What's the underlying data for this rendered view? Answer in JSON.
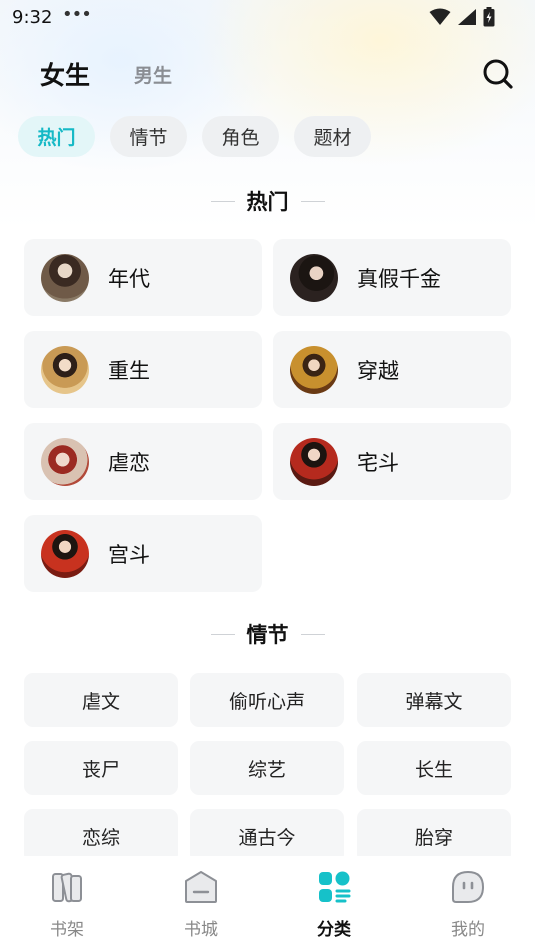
{
  "status_bar": {
    "time": "9:32",
    "dots": "•••"
  },
  "header": {
    "tab_female": "女生",
    "tab_male": "男生"
  },
  "chips": [
    {
      "label": "热门",
      "active": true
    },
    {
      "label": "情节",
      "active": false
    },
    {
      "label": "角色",
      "active": false
    },
    {
      "label": "题材",
      "active": false
    }
  ],
  "sections": {
    "hot_title": "热门",
    "plot_title": "情节"
  },
  "hot_items": [
    {
      "label": "年代",
      "avatar": "avatar-era"
    },
    {
      "label": "真假千金",
      "avatar": "avatar-true-false-heiress"
    },
    {
      "label": "重生",
      "avatar": "avatar-rebirth"
    },
    {
      "label": "穿越",
      "avatar": "avatar-time-travel"
    },
    {
      "label": "虐恋",
      "avatar": "avatar-tragic-love"
    },
    {
      "label": "宅斗",
      "avatar": "avatar-household-intrigue"
    },
    {
      "label": "宫斗",
      "avatar": "avatar-palace-intrigue"
    }
  ],
  "plot_items": [
    "虐文",
    "偷听心声",
    "弹幕文",
    "丧尸",
    "综艺",
    "长生",
    "恋综",
    "通古今",
    "胎穿"
  ],
  "bottom_nav": [
    {
      "label": "书架",
      "icon": "bookshelf-icon",
      "active": false
    },
    {
      "label": "书城",
      "icon": "bookstore-icon",
      "active": false
    },
    {
      "label": "分类",
      "icon": "category-icon",
      "active": true
    },
    {
      "label": "我的",
      "icon": "profile-icon",
      "active": false
    }
  ],
  "colors": {
    "accent": "#16b9c6",
    "card_bg": "#f5f6f7",
    "chip_bg": "#eef0f2"
  }
}
